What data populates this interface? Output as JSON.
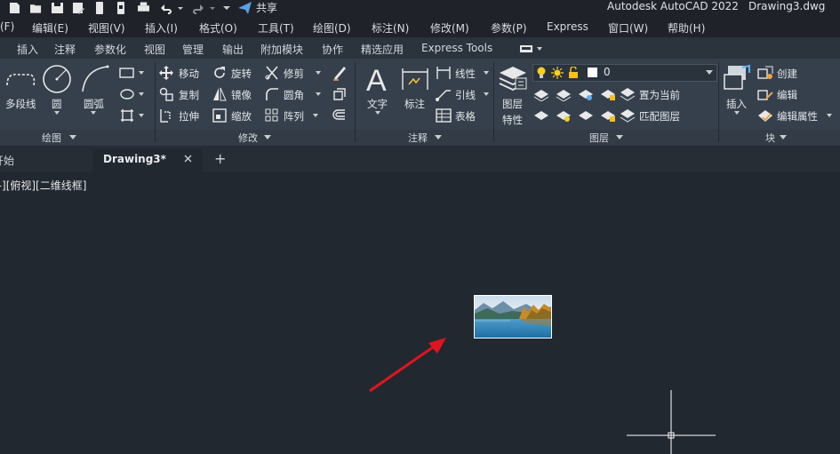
{
  "app_title": "Autodesk AutoCAD 2022",
  "file_title": "Drawing3.dwg",
  "qat": {
    "share_label": "共享"
  },
  "menu": [
    "(F)",
    "编辑(E)",
    "视图(V)",
    "插入(I)",
    "格式(O)",
    "工具(T)",
    "绘图(D)",
    "标注(N)",
    "修改(M)",
    "参数(P)",
    "Express",
    "窗口(W)",
    "帮助(H)"
  ],
  "ribbon_tabs": [
    "插入",
    "注释",
    "参数化",
    "视图",
    "管理",
    "输出",
    "附加模块",
    "协作",
    "精选应用",
    "Express Tools"
  ],
  "panels": {
    "draw": {
      "title": "绘图",
      "polyline": "多段线",
      "circle": "圆",
      "arc": "圆弧"
    },
    "modify": {
      "title": "修改",
      "move": "移动",
      "rotate": "旋转",
      "trim": "修剪",
      "copy": "复制",
      "mirror": "镜像",
      "fillet": "圆角",
      "stretch": "拉伸",
      "scale": "缩放",
      "array": "阵列"
    },
    "annotation": {
      "title": "注释",
      "text": "文字",
      "dimension": "标注",
      "linear": "线性",
      "leader": "引线",
      "table": "表格"
    },
    "layers": {
      "title": "图层",
      "layer_props_line1": "图层",
      "layer_props_line2": "特性",
      "current_layer": "0",
      "set_current": "置为当前",
      "match_layer": "匹配图层"
    },
    "block": {
      "title": "块",
      "insert": "插入",
      "create": "创建",
      "edit": "编辑",
      "edit_attributes": "编辑属性"
    }
  },
  "doc_tabs": {
    "start": "开始",
    "active": "Drawing3*",
    "new_tab": "+"
  },
  "canvas": {
    "label": "[-][俯视][二维线框]"
  },
  "colors": {
    "accent_arrow": "#e0141c",
    "canvas_bg": "#212830"
  }
}
